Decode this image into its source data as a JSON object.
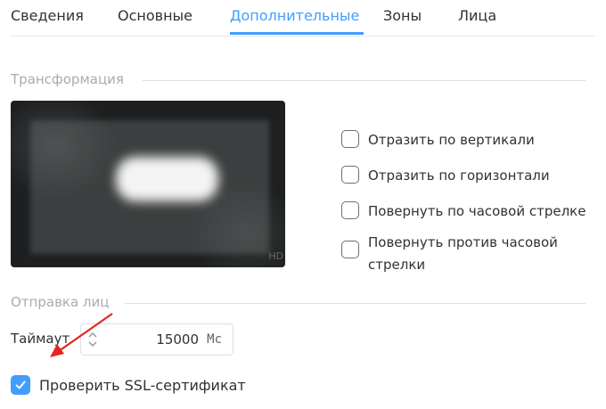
{
  "tabs": [
    {
      "label": "Сведения",
      "active": false
    },
    {
      "label": "Основные",
      "active": false
    },
    {
      "label": "Дополнительные",
      "active": true
    },
    {
      "label": "Зоны",
      "active": false
    },
    {
      "label": "Лица",
      "active": false
    }
  ],
  "transform": {
    "title": "Трансформация",
    "options": [
      {
        "label": "Отразить по вертикали",
        "checked": false
      },
      {
        "label": "Отразить по горизонтали",
        "checked": false
      },
      {
        "label": "Повернуть по часовой стрелке",
        "checked": false
      },
      {
        "label_line1": "Повернуть против часовой",
        "label_line2": "стрелки",
        "checked": false
      }
    ],
    "preview_tag": "HD"
  },
  "faces": {
    "title": "Отправка лиц",
    "timeout_label": "Таймаут",
    "timeout_value": "15000",
    "timeout_unit": "Мс",
    "ssl_label": "Проверить SSL-сертификат",
    "ssl_checked": true
  },
  "colors": {
    "accent": "#409eff",
    "annotation_arrow": "#e5251f"
  }
}
